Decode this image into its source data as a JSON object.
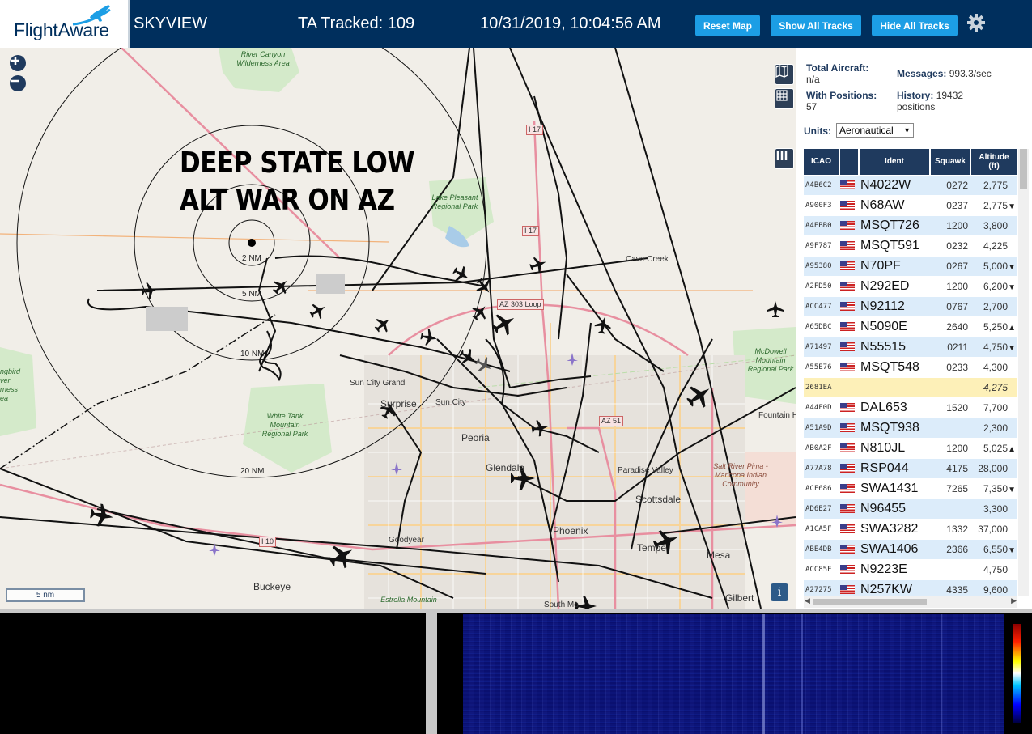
{
  "header": {
    "logo_text": "FlightAware",
    "app_name": "SKYVIEW",
    "tracked_label": "TA Tracked: 109",
    "datetime": "10/31/2019, 10:04:56 AM",
    "buttons": {
      "reset": "Reset Map",
      "show": "Show All Tracks",
      "hide": "Hide All Tracks"
    },
    "settings_icon": "gear-icon"
  },
  "map": {
    "overlay_text": [
      "DEEP STATE LOW",
      "ALT WAR ON AZ"
    ],
    "range_rings": [
      "2 NM",
      "5 NM",
      "10 NM",
      "20 NM"
    ],
    "scale": "5 nm",
    "info_label": "i",
    "places": {
      "river_canyon": "River Canyon Wilderness Area",
      "lake_pleasant": "Lake Pleasant Regional Park",
      "white_tank": "White Tank Mountain Regional Park",
      "mcdowell": "McDowell Mountain Regional Park",
      "salt_river": "Salt River Pima - Maricopa Indian Community",
      "estrella": "Estrella Mountain",
      "wilderness_left": "ngbird ver rness ea",
      "sun_city_grand": "Sun City Grand",
      "surprise": "Surprise",
      "sun_city": "Sun City",
      "peoria": "Peoria",
      "glendale": "Glendale",
      "paradise_valley": "Paradise Valley",
      "scottsdale": "Scottsdale",
      "phoenix": "Phoenix",
      "tempe": "Tempe",
      "mesa": "Mesa",
      "gilbert": "Gilbert",
      "buckeye": "Buckeye",
      "goodyear": "Goodyear",
      "cave_creek": "Cave Creek",
      "fountain": "Fountain H",
      "south_mountain": "South Mo"
    },
    "roads": {
      "i17a": "I 17",
      "i17b": "I 17",
      "loop303": "AZ 303 Loop",
      "az51": "AZ 51",
      "i10": "I 10"
    }
  },
  "stats": {
    "total_label": "Total Aircraft:",
    "total_value": "n/a",
    "messages_label": "Messages:",
    "messages_value": "993.3/sec",
    "positions_label": "With Positions:",
    "positions_value": "57",
    "history_label": "History:",
    "history_value": "19432 positions",
    "units_label": "Units:",
    "units_value": "Aeronautical"
  },
  "table": {
    "headers": {
      "icao": "ICAO",
      "ident": "Ident",
      "squawk": "Squawk",
      "altitude": "Altitude (ft)"
    },
    "rows": [
      {
        "icao": "A4B6C2",
        "flag": true,
        "ident": "N4022W",
        "squawk": "0272",
        "alt": "2,775",
        "trend": ""
      },
      {
        "icao": "A900F3",
        "flag": true,
        "ident": "N68AW",
        "squawk": "0237",
        "alt": "2,775",
        "trend": "▼"
      },
      {
        "icao": "A4EBB0",
        "flag": true,
        "ident": "MSQT726",
        "squawk": "1200",
        "alt": "3,800",
        "trend": ""
      },
      {
        "icao": "A9F787",
        "flag": true,
        "ident": "MSQT591",
        "squawk": "0232",
        "alt": "4,225",
        "trend": ""
      },
      {
        "icao": "A95380",
        "flag": true,
        "ident": "N70PF",
        "squawk": "0267",
        "alt": "5,000",
        "trend": "▼"
      },
      {
        "icao": "A2FD50",
        "flag": true,
        "ident": "N292ED",
        "squawk": "1200",
        "alt": "6,200",
        "trend": "▼"
      },
      {
        "icao": "ACC477",
        "flag": true,
        "ident": "N92112",
        "squawk": "0767",
        "alt": "2,700",
        "trend": ""
      },
      {
        "icao": "A65DBC",
        "flag": true,
        "ident": "N5090E",
        "squawk": "2640",
        "alt": "5,250",
        "trend": "▲"
      },
      {
        "icao": "A71497",
        "flag": true,
        "ident": "N55515",
        "squawk": "0211",
        "alt": "4,750",
        "trend": "▼"
      },
      {
        "icao": "A55E76",
        "flag": true,
        "ident": "MSQT548",
        "squawk": "0233",
        "alt": "4,300",
        "trend": ""
      },
      {
        "icao": "2681EA",
        "flag": false,
        "ident": "",
        "squawk": "",
        "alt": "4,275",
        "trend": "",
        "highlight": true
      },
      {
        "icao": "A44F0D",
        "flag": true,
        "ident": "DAL653",
        "squawk": "1520",
        "alt": "7,700",
        "trend": ""
      },
      {
        "icao": "A51A9D",
        "flag": true,
        "ident": "MSQT938",
        "squawk": "",
        "alt": "2,300",
        "trend": ""
      },
      {
        "icao": "AB0A2F",
        "flag": true,
        "ident": "N810JL",
        "squawk": "1200",
        "alt": "5,025",
        "trend": "▲"
      },
      {
        "icao": "A77A78",
        "flag": true,
        "ident": "RSP044",
        "squawk": "4175",
        "alt": "28,000",
        "trend": ""
      },
      {
        "icao": "ACF686",
        "flag": true,
        "ident": "SWA1431",
        "squawk": "7265",
        "alt": "7,350",
        "trend": "▼"
      },
      {
        "icao": "AD6E27",
        "flag": true,
        "ident": "N96455",
        "squawk": "",
        "alt": "3,300",
        "trend": ""
      },
      {
        "icao": "A1CA5F",
        "flag": true,
        "ident": "SWA3282",
        "squawk": "1332",
        "alt": "37,000",
        "trend": ""
      },
      {
        "icao": "ABE4DB",
        "flag": true,
        "ident": "SWA1406",
        "squawk": "2366",
        "alt": "6,550",
        "trend": "▼"
      },
      {
        "icao": "ACC85E",
        "flag": true,
        "ident": "N9223E",
        "squawk": "",
        "alt": "4,750",
        "trend": ""
      },
      {
        "icao": "A27275",
        "flag": true,
        "ident": "N257KW",
        "squawk": "4335",
        "alt": "9,600",
        "trend": ""
      }
    ]
  },
  "colors": {
    "header_bg": "#002f5d",
    "button": "#1c9ee5",
    "table_header": "#1f3a5e",
    "row_highlight": "#fdf0b8"
  }
}
